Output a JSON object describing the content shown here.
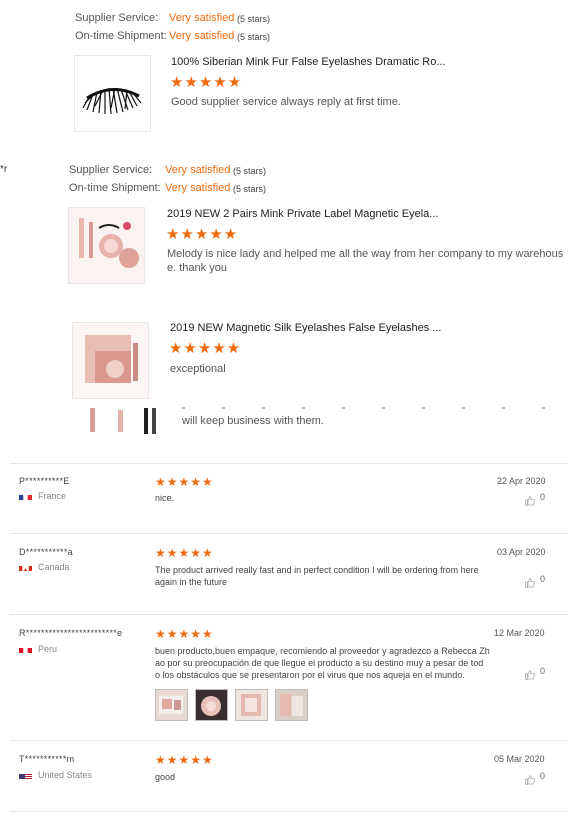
{
  "supplier_reviews": [
    {
      "service_label": "Supplier Service:",
      "service_value": "Very satisfied",
      "service_stars": "(5 stars)",
      "shipment_label": "On-time Shipment:",
      "shipment_value": "Very satisfied",
      "shipment_stars": "(5 stars)",
      "product_title": "100% Siberian Mink Fur False Eyelashes Dramatic Ro...",
      "stars": "★★★★★",
      "comment": "Good supplier service always reply at first time."
    },
    {
      "prefix": "*r",
      "service_label": "Supplier Service:",
      "service_value": "Very satisfied",
      "service_stars": "(5 stars)",
      "shipment_label": "On-time Shipment:",
      "shipment_value": "Very satisfied",
      "shipment_stars": "(5 stars)",
      "product_title": "2019 NEW 2 Pairs Mink Private Label Magnetic Eyela...",
      "stars": "★★★★★",
      "comment_line1": "Melody is nice lady and helped me all the way from her company to my warehous",
      "comment_line2": "e. thank you"
    },
    {
      "product_title": "2019 NEW Magnetic Silk Eyelashes False Eyelashes ...",
      "stars": "★★★★★",
      "comment": "exceptional",
      "partial_comment": "will keep business with them."
    }
  ],
  "buyer_reviews": [
    {
      "name": "P**********E",
      "country": "France",
      "stars": "★★★★★",
      "text": "nice.",
      "date": "22 Apr 2020",
      "likes": "0"
    },
    {
      "name": "D***********a",
      "country": "Canada",
      "stars": "★★★★★",
      "text_line1": "The product arrived really fast and in perfect condition I will be ordering from here",
      "text_line2": "again in the future",
      "date": "03 Apr 2020",
      "likes": "0"
    },
    {
      "name": "R************************e",
      "country": "Peru",
      "stars": "★★★★★",
      "text_line1": "buen producto,buen empaque, recomiendo al proveedor y agradezco a Rebecca Zh",
      "text_line2": "ao por su preocupación de que llegue el producto a su destino  muy a pesar de tod",
      "text_line3": "o los obstáculos que se presentaron por el virus que nos aqueja en el mundo.",
      "date": "12 Mar 2020",
      "likes": "0"
    },
    {
      "name": "T***********m",
      "country": "United States",
      "stars": "★★★★★",
      "text": "good",
      "date": "05 Mar 2020",
      "likes": "0"
    }
  ],
  "colors": {
    "accent": "#f06a0f",
    "divider": "#e5e5e5"
  }
}
